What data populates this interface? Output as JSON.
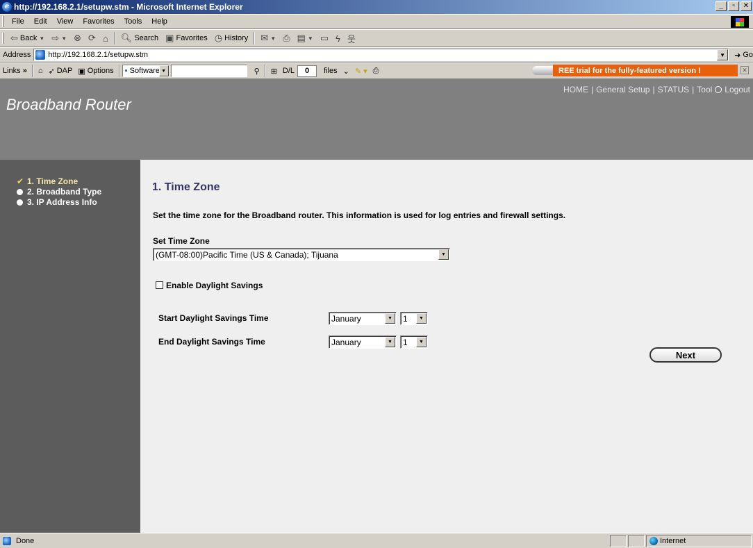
{
  "window": {
    "title": "http://192.168.2.1/setupw.stm - Microsoft Internet Explorer"
  },
  "menubar": {
    "items": [
      "File",
      "Edit",
      "View",
      "Favorites",
      "Tools",
      "Help"
    ]
  },
  "toolbar": {
    "back": "Back",
    "search": "Search",
    "favorites": "Favorites",
    "history": "History"
  },
  "address": {
    "label": "Address",
    "url": "http://192.168.2.1/setupw.stm",
    "go": "Go"
  },
  "links": {
    "label": "Links",
    "dap": "DAP",
    "options": "Options",
    "software": "Software",
    "dl_label": "D/L",
    "dl_count": "0",
    "files": "files",
    "promo": "REE trial for the fully-featured version !"
  },
  "header": {
    "brand": "Broadband Router",
    "nav": [
      "HOME",
      "General Setup",
      "STATUS",
      "Tool",
      "Logout"
    ]
  },
  "sidebar": {
    "items": [
      "1. Time Zone",
      "2. Broadband Type",
      "3. IP Address Info"
    ]
  },
  "main": {
    "title": "1. Time Zone",
    "description": "Set the time zone for the Broadband router. This information is used for log entries and firewall settings.",
    "timezone_label": "Set Time Zone",
    "timezone_value": "(GMT-08:00)Pacific Time (US & Canada); Tijuana",
    "daylight_label": "Enable Daylight Savings",
    "start_label": "Start Daylight Savings Time",
    "end_label": "End Daylight Savings Time",
    "start_month": "January",
    "start_day": "1",
    "end_month": "January",
    "end_day": "1",
    "next": "Next"
  },
  "status": {
    "text": "Done",
    "zone": "Internet"
  }
}
